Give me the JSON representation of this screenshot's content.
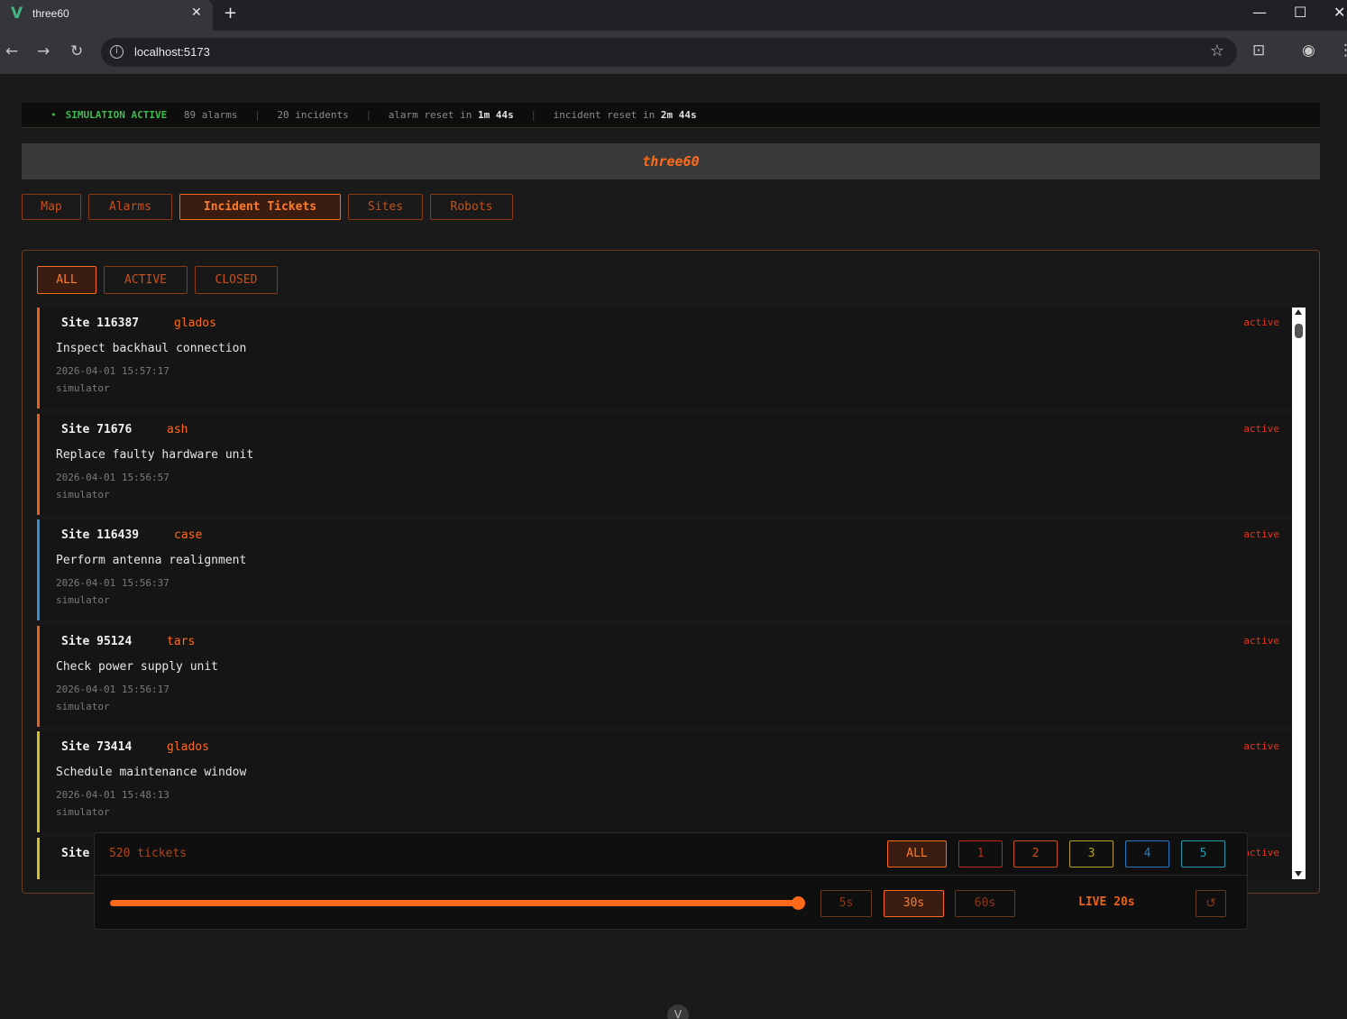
{
  "browser": {
    "tab_title": "three60",
    "tab_close": "✕",
    "new_tab": "+",
    "url": "localhost:5173"
  },
  "status": {
    "simulation": "SIMULATION ACTIVE",
    "alarms": "89 alarms",
    "incidents": "20 incidents",
    "alarm_reset_label": "alarm reset in",
    "alarm_reset_value": "1m 44s",
    "incident_reset_label": "incident reset in",
    "incident_reset_value": "2m 44s"
  },
  "brand": "three60",
  "nav": {
    "map": "Map",
    "alarms": "Alarms",
    "incident_tickets": "Incident Tickets",
    "sites": "Sites",
    "robots": "Robots",
    "active": "Incident Tickets"
  },
  "filters": {
    "all": "ALL",
    "active": "ACTIVE",
    "closed": "CLOSED",
    "selected": "ALL"
  },
  "tickets": [
    {
      "site": "Site 116387",
      "robot": "glados",
      "title": "Inspect backhaul connection",
      "date": "2026-04-01 15:57:17",
      "source": "simulator",
      "state": "active",
      "color": "#e8621a"
    },
    {
      "site": "Site 71676",
      "robot": "ash",
      "title": "Replace faulty hardware unit",
      "date": "2026-04-01 15:56:57",
      "source": "simulator",
      "state": "active",
      "color": "#e8621a"
    },
    {
      "site": "Site 116439",
      "robot": "case",
      "title": "Perform antenna realignment",
      "date": "2026-04-01 15:56:37",
      "source": "simulator",
      "state": "active",
      "color": "#3a8fd0"
    },
    {
      "site": "Site 95124",
      "robot": "tars",
      "title": "Check power supply unit",
      "date": "2026-04-01 15:56:17",
      "source": "simulator",
      "state": "active",
      "color": "#e8621a"
    },
    {
      "site": "Site 73414",
      "robot": "glados",
      "title": "Schedule maintenance window",
      "date": "2026-04-01 15:48:13",
      "source": "simulator",
      "state": "active",
      "color": "#d8c020"
    },
    {
      "site": "Site",
      "robot": "",
      "title": "",
      "date": "",
      "source": "",
      "state": "active",
      "color": "#d8c020"
    }
  ],
  "pager": {
    "count": "520 tickets",
    "all": "ALL",
    "levels": [
      {
        "label": "1",
        "color": "#c02818"
      },
      {
        "label": "2",
        "color": "#c8501a"
      },
      {
        "label": "3",
        "color": "#b8a020"
      },
      {
        "label": "4",
        "color": "#2a7ac0"
      },
      {
        "label": "5",
        "color": "#2a9ab0"
      }
    ]
  },
  "timeline": {
    "slider_level": 1.0,
    "intervals": [
      "5s",
      "30s",
      "60s"
    ],
    "selected_interval": "30s",
    "live": "LIVE 20s",
    "reset_icon": "↺"
  }
}
